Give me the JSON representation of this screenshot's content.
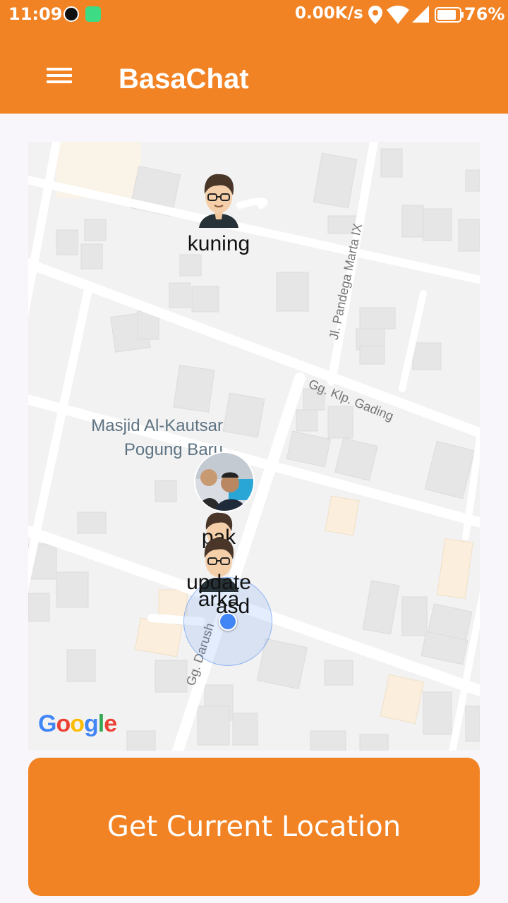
{
  "status_bar": {
    "time": "11:09",
    "net_speed": "0.00K/s",
    "battery": "76%",
    "icons": [
      "zoom-notification-icon",
      "android-notification-icon",
      "location-icon",
      "wifi-icon",
      "signal-icon",
      "battery-icon"
    ]
  },
  "app_bar": {
    "title": "BasaChat",
    "menu_icon": "hamburger-menu-icon"
  },
  "map": {
    "street_labels": {
      "pandega": "Jl. Pandega Marta IX",
      "gading": "Gg. Klp. Gading",
      "darush": "Gg. Darush"
    },
    "poi": {
      "line1": "Masjid Al-Kautsar",
      "line2": "Pogung Baru"
    },
    "markers": {
      "kuning": "kuning",
      "m2": "pak",
      "m3": "update",
      "m4": "arka",
      "m5": "asd"
    },
    "attribution": "Google"
  },
  "colors": {
    "primary": "#f28324",
    "my_location": "#4285f4"
  },
  "button": {
    "label": "Get Current Location"
  }
}
